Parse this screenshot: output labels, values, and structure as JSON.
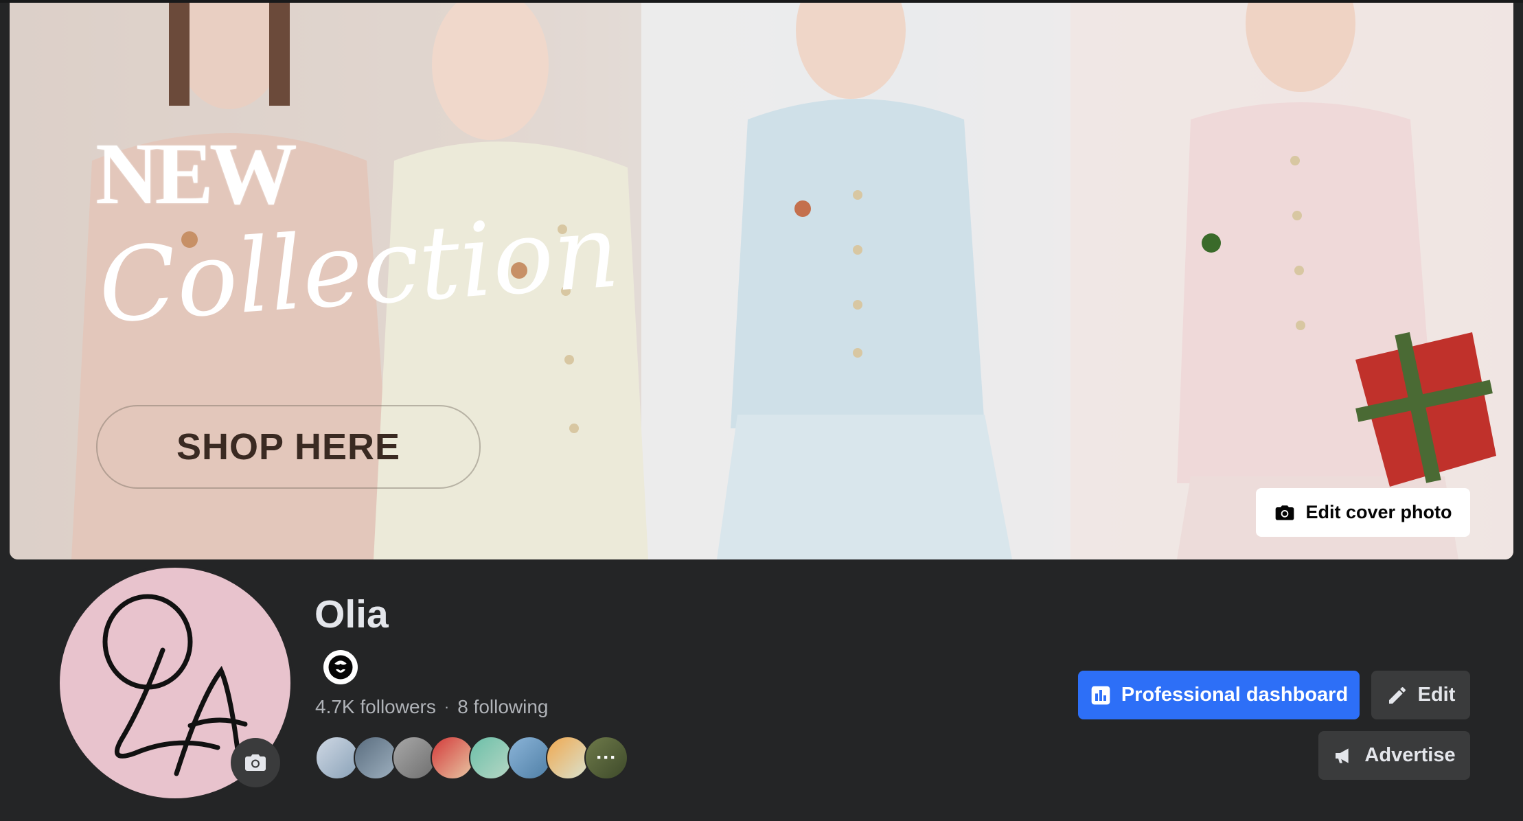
{
  "cover": {
    "headline": "NEW",
    "script_text": "Collection",
    "cta": "SHOP HERE",
    "edit_button": "Edit cover photo"
  },
  "profile": {
    "name": "Olia",
    "logo_text": "OLA",
    "followers": "4.7K followers",
    "separator": "·",
    "following": "8 following",
    "more_followers": "···"
  },
  "actions": {
    "dashboard": "Professional dashboard",
    "edit": "Edit",
    "advertise": "Advertise"
  },
  "colors": {
    "background": "#242526",
    "primary_button": "#2d6ff7",
    "secondary_button": "#3a3b3c",
    "avatar_bg": "#e8c3cd"
  },
  "icons": {
    "edit_cover": "camera-icon",
    "avatar_camera": "camera-icon",
    "dashboard": "bar-chart-icon",
    "edit": "pencil-icon",
    "advertise": "megaphone-icon",
    "verified": "professional-mode-icon"
  }
}
